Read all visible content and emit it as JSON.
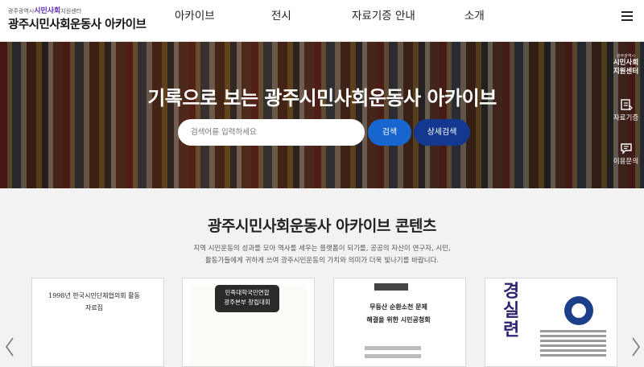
{
  "header": {
    "logo_small_prefix": "광주광역시",
    "logo_small_accent": "시민사회",
    "logo_small_suffix": "지원센터",
    "logo_main": "광주시민사회운동사 아카이브",
    "nav": [
      "아카이브",
      "전시",
      "자료기증 안내",
      "소개"
    ],
    "menu_icon": "hamburger-menu-icon"
  },
  "hero": {
    "title": "기록으로 보는 광주시민사회운동사 아카이브",
    "search_placeholder": "검색어를 입력하세요",
    "search_button": "검색",
    "detail_search_button": "상세검색"
  },
  "side_menu": {
    "logo_small": "광주광역시",
    "logo_line1": "시민사회",
    "logo_line2": "지원센터",
    "items": [
      {
        "label": "자료기증",
        "icon": "donate-book-icon"
      },
      {
        "label": "이용문의",
        "icon": "chat-bubble-icon"
      }
    ]
  },
  "contents": {
    "title": "광주시민사회운동사 아카이브 콘텐츠",
    "description_line1": "지역 시민운동의 성과를 모아 역사를 세우는 플랫폼이 되기를, 공공의 자산이 연구자, 시민,",
    "description_line2": "활동가들에게 귀하게 쓰여 광주시민운동의 가치와 의미가 더욱 빛나기를 바랍니다.",
    "cards": [
      {
        "line1": "1998년 한국시민단체협의회 활동",
        "line2": "자료집"
      },
      {
        "line1": "민족대학국민연합",
        "line2": "광주본부 창립대회"
      },
      {
        "line1": "무등산 순환소천 문제",
        "line2": "해결을 위한 시민공청회"
      },
      {
        "title": "경실련"
      }
    ]
  },
  "colors": {
    "search_button": "#1766d0",
    "detail_button": "#14388f",
    "accent_purple": "#5b2fb0"
  }
}
